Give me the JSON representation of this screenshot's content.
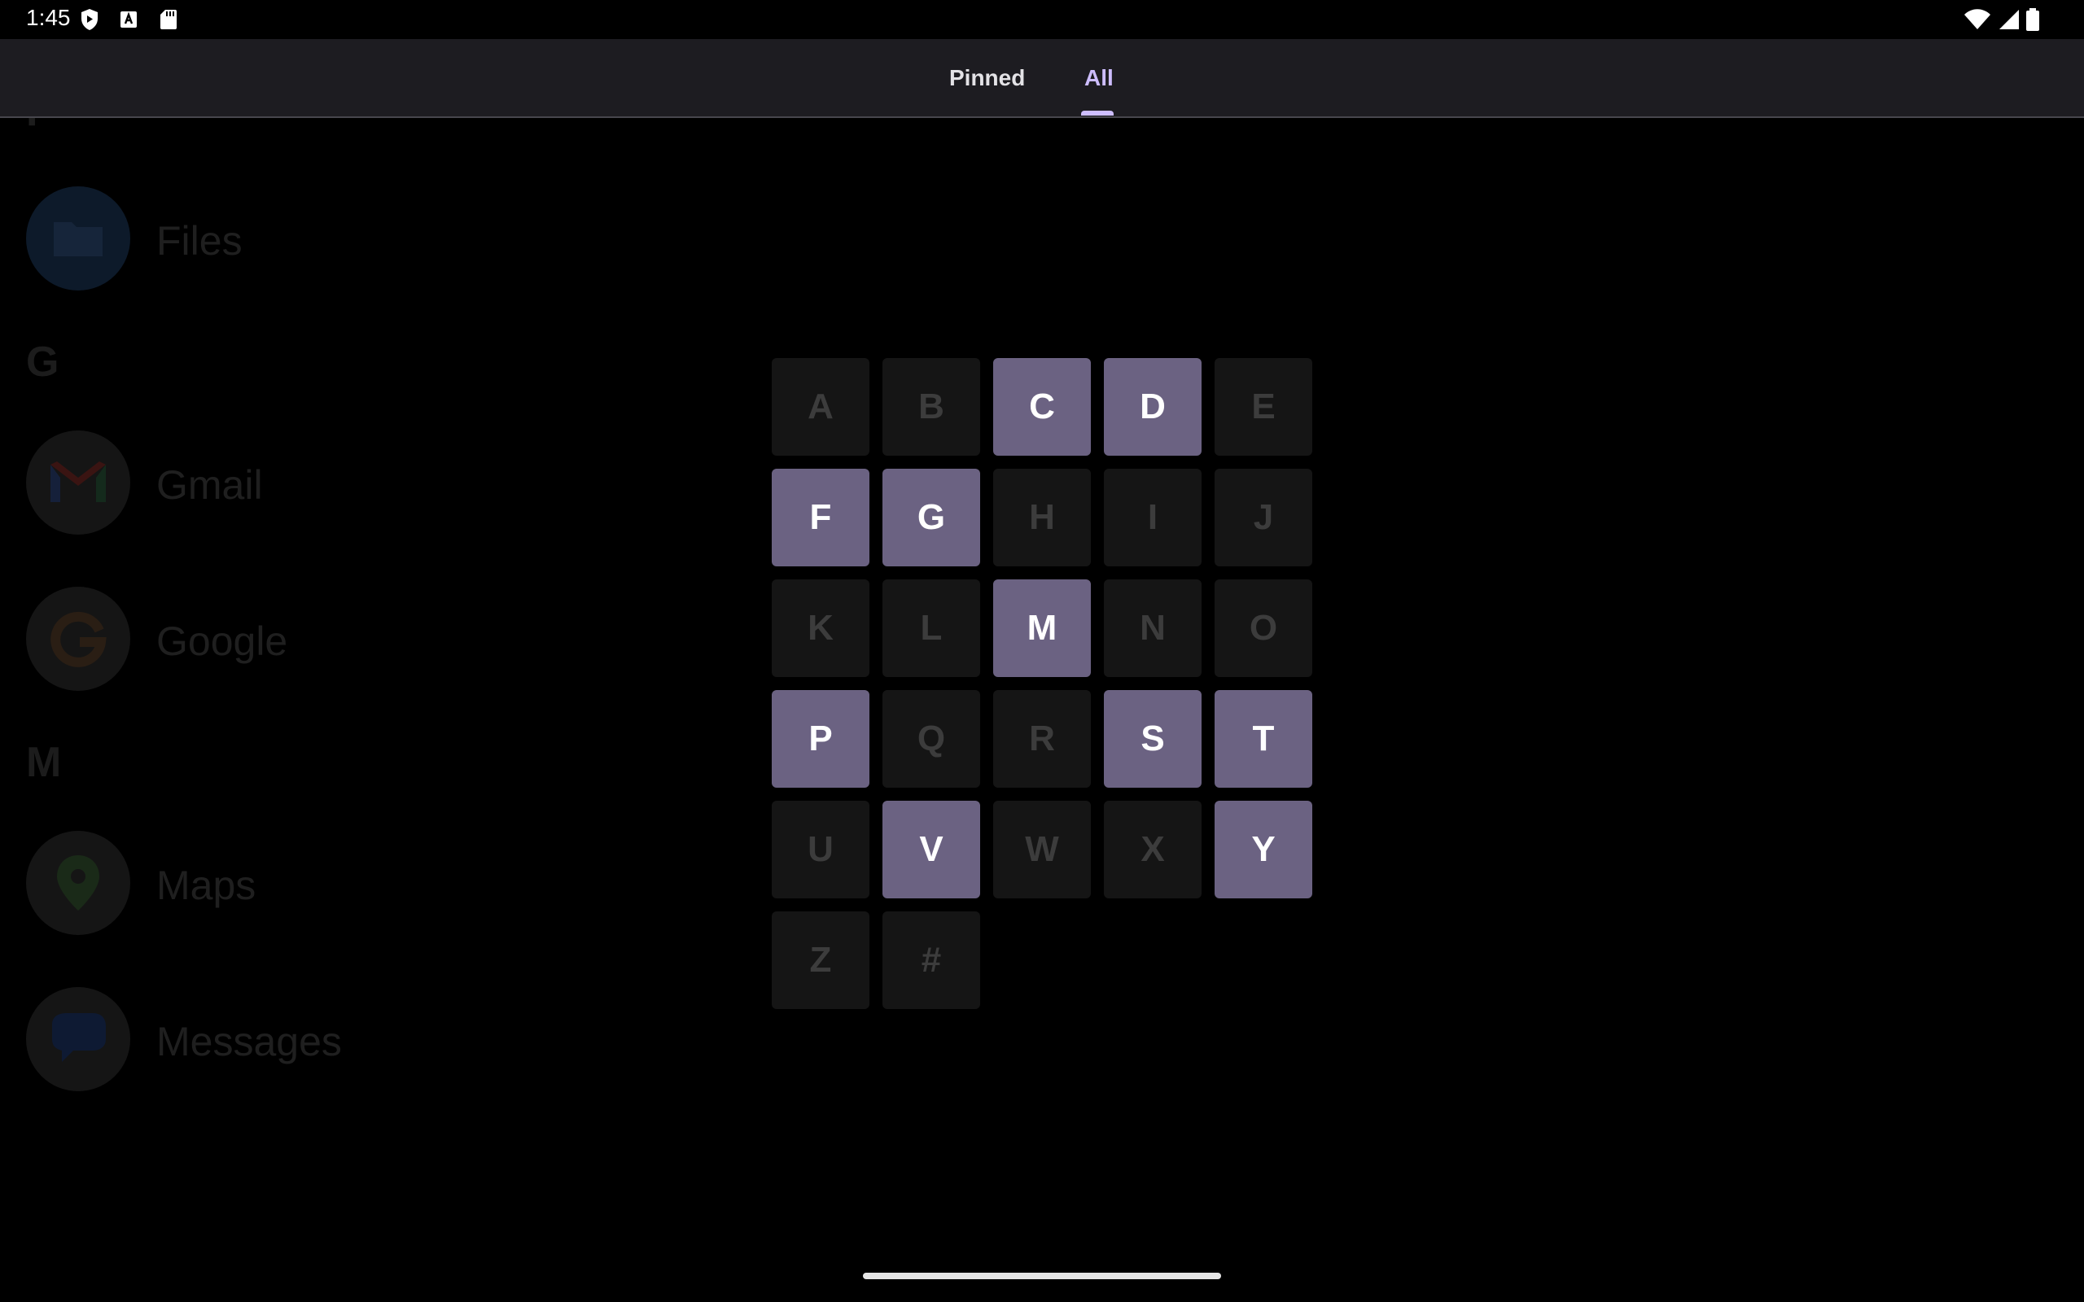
{
  "status_bar": {
    "time": "1:45",
    "left_icons": [
      "shield-icon",
      "text-a-icon",
      "sd-card-icon"
    ],
    "right_icons": [
      "wifi-icon",
      "cellular-signal-icon",
      "battery-icon"
    ]
  },
  "tabs": [
    {
      "label": "Pinned",
      "selected": false
    },
    {
      "label": "All",
      "selected": true
    }
  ],
  "accent_color": "#cdbdff",
  "app_list": {
    "sections": [
      {
        "letter": "F",
        "apps": [
          "Files"
        ]
      },
      {
        "letter": "G",
        "apps": [
          "Gmail",
          "Google"
        ]
      },
      {
        "letter": "M",
        "apps": [
          "Maps",
          "Messages"
        ]
      }
    ]
  },
  "letter_grid": {
    "letters": [
      {
        "label": "A",
        "enabled": false
      },
      {
        "label": "B",
        "enabled": false
      },
      {
        "label": "C",
        "enabled": true
      },
      {
        "label": "D",
        "enabled": true
      },
      {
        "label": "E",
        "enabled": false
      },
      {
        "label": "F",
        "enabled": true
      },
      {
        "label": "G",
        "enabled": true
      },
      {
        "label": "H",
        "enabled": false
      },
      {
        "label": "I",
        "enabled": false
      },
      {
        "label": "J",
        "enabled": false
      },
      {
        "label": "K",
        "enabled": false
      },
      {
        "label": "L",
        "enabled": false
      },
      {
        "label": "M",
        "enabled": true
      },
      {
        "label": "N",
        "enabled": false
      },
      {
        "label": "O",
        "enabled": false
      },
      {
        "label": "P",
        "enabled": true
      },
      {
        "label": "Q",
        "enabled": false
      },
      {
        "label": "R",
        "enabled": false
      },
      {
        "label": "S",
        "enabled": true
      },
      {
        "label": "T",
        "enabled": true
      },
      {
        "label": "U",
        "enabled": false
      },
      {
        "label": "V",
        "enabled": true
      },
      {
        "label": "W",
        "enabled": false
      },
      {
        "label": "X",
        "enabled": false
      },
      {
        "label": "Y",
        "enabled": true
      },
      {
        "label": "Z",
        "enabled": false
      },
      {
        "label": "#",
        "enabled": false
      }
    ],
    "active_color": "#6b6282",
    "inactive_color": "#151515"
  }
}
